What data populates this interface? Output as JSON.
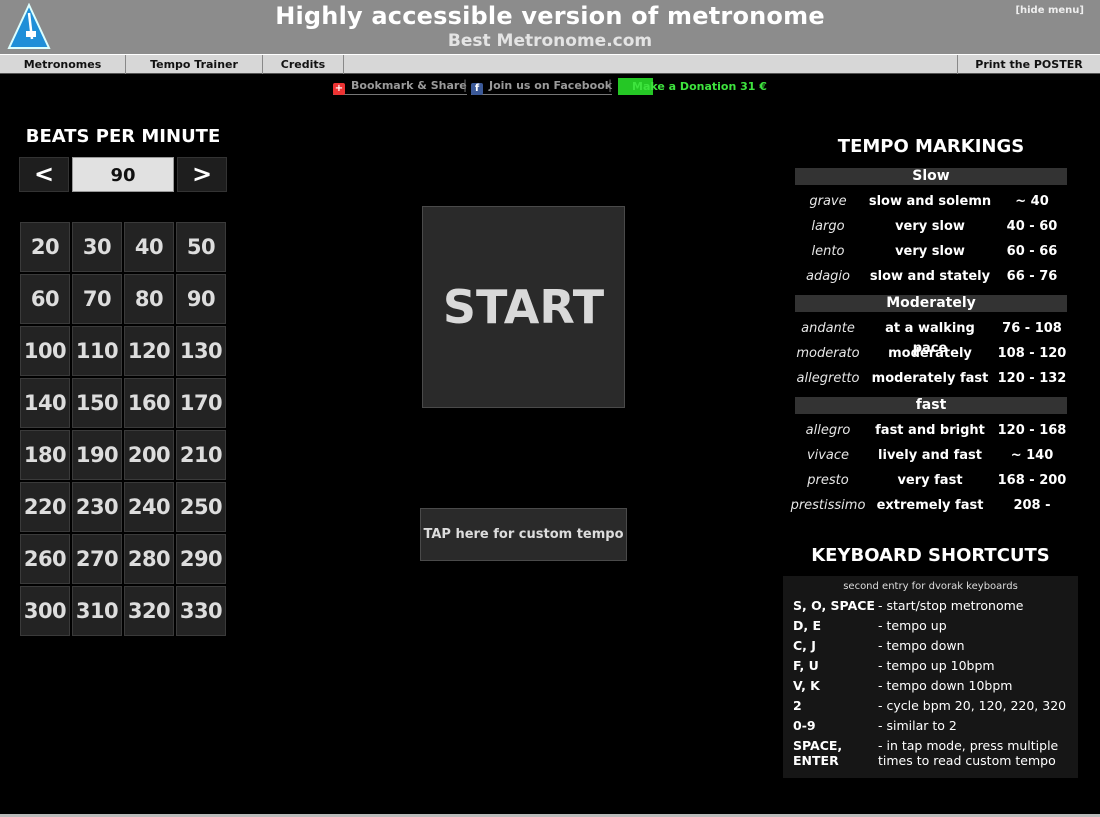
{
  "header": {
    "title": "Highly accessible version of metronome",
    "subtitle": "Best Metronome.com",
    "hide_menu": "[hide menu]"
  },
  "nav": {
    "items": [
      "Metronomes",
      "Tempo Trainer",
      "Credits"
    ],
    "right": "Print the POSTER"
  },
  "social": {
    "bookmark": "Bookmark & Share",
    "facebook": "Join us on Facebook",
    "donation": "Make a Donation 31 €"
  },
  "bpm": {
    "heading": "BEATS PER MINUTE",
    "value": "90",
    "decrease": "<",
    "increase": ">",
    "presets": [
      "20",
      "30",
      "40",
      "50",
      "60",
      "70",
      "80",
      "90",
      "100",
      "110",
      "120",
      "130",
      "140",
      "150",
      "160",
      "170",
      "180",
      "190",
      "200",
      "210",
      "220",
      "230",
      "240",
      "250",
      "260",
      "270",
      "280",
      "290",
      "300",
      "310",
      "320",
      "330"
    ]
  },
  "center": {
    "start": "START",
    "tap": "TAP here for custom tempo"
  },
  "tempo_markings": {
    "heading": "TEMPO MARKINGS",
    "sections": [
      {
        "name": "Slow",
        "rows": [
          {
            "term": "grave",
            "desc": "slow and solemn",
            "range": "~ 40"
          },
          {
            "term": "largo",
            "desc": "very slow",
            "range": "40 - 60"
          },
          {
            "term": "lento",
            "desc": "very slow",
            "range": "60 - 66"
          },
          {
            "term": "adagio",
            "desc": "slow and stately",
            "range": "66 - 76"
          }
        ]
      },
      {
        "name": "Moderately",
        "rows": [
          {
            "term": "andante",
            "desc": "at a walking pace",
            "range": "76 - 108"
          },
          {
            "term": "moderato",
            "desc": "moderately",
            "range": "108 - 120"
          },
          {
            "term": "allegretto",
            "desc": "moderately fast",
            "range": "120 - 132"
          }
        ]
      },
      {
        "name": "fast",
        "rows": [
          {
            "term": "allegro",
            "desc": "fast and bright",
            "range": "120 - 168"
          },
          {
            "term": "vivace",
            "desc": "lively and fast",
            "range": "~ 140"
          },
          {
            "term": "presto",
            "desc": "very fast",
            "range": "168 - 200"
          },
          {
            "term": "prestissimo",
            "desc": "extremely fast",
            "range": "208 -"
          }
        ]
      }
    ]
  },
  "shortcuts": {
    "heading": "KEYBOARD SHORTCUTS",
    "note": "second entry for dvorak keyboards",
    "rows": [
      {
        "keys": "S, O, SPACE",
        "desc": "- start/stop metronome"
      },
      {
        "keys": "D, E",
        "desc": "- tempo up"
      },
      {
        "keys": "C, J",
        "desc": "- tempo down"
      },
      {
        "keys": "F, U",
        "desc": "- tempo up 10bpm"
      },
      {
        "keys": "V, K",
        "desc": "- tempo down 10bpm"
      },
      {
        "keys": "2",
        "desc": "- cycle bpm 20, 120, 220, 320"
      },
      {
        "keys": "0-9",
        "desc": "- similar to 2"
      },
      {
        "keys": "SPACE,\nENTER",
        "desc": "- in tap mode, press multiple\ntimes to read custom tempo"
      }
    ]
  },
  "colors": {
    "header_bg": "#8c8c8c",
    "nav_bg": "#d7d7d7",
    "donation_green": "#25c725",
    "page_bg": "#000000"
  }
}
